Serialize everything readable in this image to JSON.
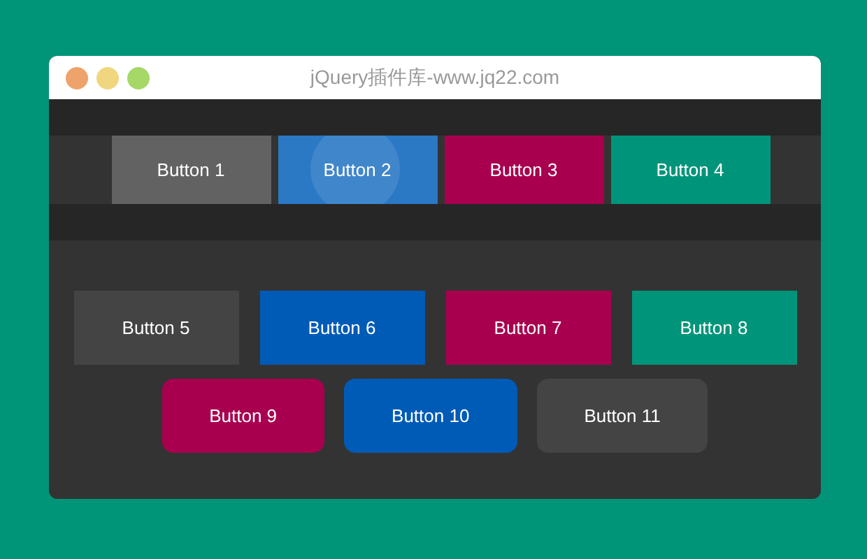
{
  "window": {
    "title": "jQuery插件库-www.jq22.com"
  },
  "top_bar": {
    "buttons": [
      {
        "label": "Button 1",
        "color": "#626262",
        "pressed": false
      },
      {
        "label": "Button 2",
        "color": "#2b78c5",
        "pressed": true
      },
      {
        "label": "Button 3",
        "color": "#a8004f",
        "pressed": false
      },
      {
        "label": "Button 4",
        "color": "#00957a",
        "pressed": false
      }
    ]
  },
  "button_rows": [
    {
      "kind": "square",
      "buttons": [
        {
          "label": "Button 5",
          "color": "#444444"
        },
        {
          "label": "Button 6",
          "color": "#005bb7"
        },
        {
          "label": "Button 7",
          "color": "#a8004f"
        },
        {
          "label": "Button 8",
          "color": "#00957a"
        }
      ]
    },
    {
      "kind": "rounded",
      "buttons": [
        {
          "label": "Button 9",
          "color": "#a8004f"
        },
        {
          "label": "Button 10",
          "color": "#005bb7"
        },
        {
          "label": "Button 11",
          "color": "#444444"
        }
      ]
    }
  ]
}
